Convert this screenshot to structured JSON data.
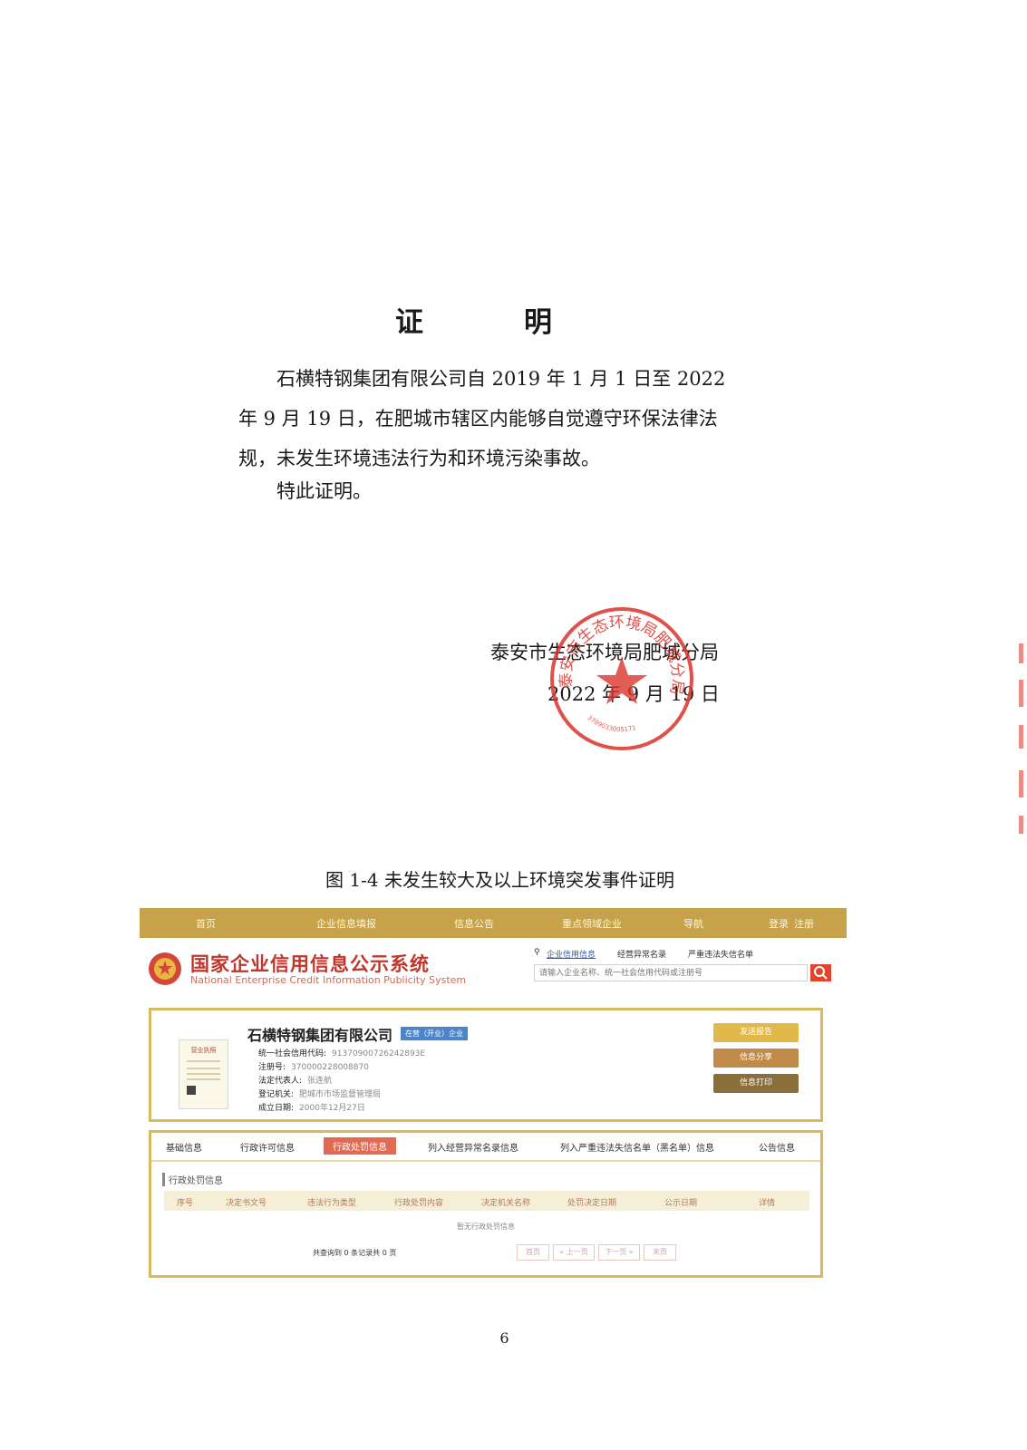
{
  "certificate": {
    "title": "证　明",
    "body": "石横特钢集团有限公司自 2019 年 1 月 1 日至 2022 年 9 月 19 日，在肥城市辖区内能够自觉遵守环保法律法规，未发生环境违法行为和环境污染事故。",
    "closing": "特此证明。",
    "issuer": "泰安市生态环境局肥城分局",
    "date": "2022 年 9 月 19 日",
    "seal_text": "泰安市生态环境局肥城分局",
    "seal_number": "3709033005171",
    "seal_color": "#d9342b"
  },
  "figure_caption": "图 1-4 未发生较大及以上环境突发事件证明",
  "page_number": "6",
  "screenshot": {
    "nav": {
      "home": "首页",
      "annual_report": "企业信息填报",
      "announcements": "信息公告",
      "key_industries": "重点领域企业",
      "guide": "导航",
      "login": "登录",
      "register": "注册"
    },
    "site_title": "国家企业信用信息公示系统",
    "site_subtitle": "National Enterprise Credit Information Publicity System",
    "search": {
      "tabs": [
        "企业信用信息",
        "经营异常名录",
        "严重违法失信名单"
      ],
      "placeholder": "请输入企业名称、统一社会信用代码或注册号"
    },
    "company": {
      "name": "石横特钢集团有限公司",
      "status": "在营（开业）企业",
      "fields": [
        {
          "label": "统一社会信用代码:",
          "value": "91370900726242893E"
        },
        {
          "label": "注册号:",
          "value": "370000228008870"
        },
        {
          "label": "法定代表人:",
          "value": "张连航"
        },
        {
          "label": "登记机关:",
          "value": "肥城市市场监督管理局"
        },
        {
          "label": "成立日期:",
          "value": "2000年12月27日"
        }
      ],
      "license_label": "营业执照",
      "buttons": {
        "send_report": "发送报告",
        "share": "信息分享",
        "print": "信息打印"
      }
    },
    "tabs": [
      "基础信息",
      "行政许可信息",
      "行政处罚信息",
      "列入经营异常名录信息",
      "列入严重违法失信名单（黑名单）信息",
      "公告信息"
    ],
    "section_heading": "行政处罚信息",
    "table_headers": [
      "序号",
      "决定书文号",
      "违法行为类型",
      "行政处罚内容",
      "决定机关名称",
      "处罚决定日期",
      "公示日期",
      "详情"
    ],
    "empty_message": "暂无行政处罚信息",
    "pager": {
      "summary": "共查询到 0 条记录共 0 页",
      "first": "首页",
      "prev": "« 上一页",
      "next": "下一页 »",
      "last": "末页"
    },
    "colors": {
      "nav_bar": "#c6a34a",
      "title_red": "#c1352b",
      "card_border": "#d9b95e",
      "btn_gold": "#e0b94a",
      "btn_brown": "#c08a4a",
      "btn_dark": "#8a6f3a",
      "active_tab": "#e16a55"
    }
  }
}
